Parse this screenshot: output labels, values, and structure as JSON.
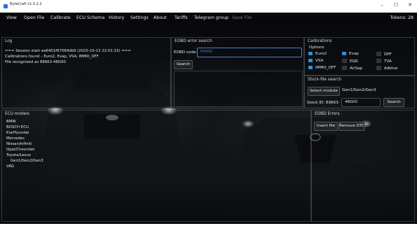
{
  "window": {
    "title": "ByteCraft v1.0.2.2"
  },
  "menu": {
    "items": [
      "View",
      "Open File",
      "Calibrate",
      "ECU Schema",
      "History",
      "Settings",
      "About",
      "Tariffs",
      "Telegram group"
    ],
    "save_file": "Save File",
    "tokens": "Tokens: 28"
  },
  "log": {
    "title": "Log",
    "lines": [
      "=== Session start ea6401f87064db9 (2025-10-13 22:01:15) ===",
      "Calibrations found – Euro2, Evap, VSA, IMMO_OFF",
      "File recognised as 89663-48G00"
    ]
  },
  "eobd_search": {
    "title": "EOBD error search",
    "code_label": "EOBD code:",
    "placeholder": "P0000",
    "search_button": "Search"
  },
  "calibrations": {
    "title": "Calibrations",
    "options_label": "Options",
    "items": [
      {
        "label": "Euro2",
        "checked": true
      },
      {
        "label": "Evap",
        "checked": true
      },
      {
        "label": "DPF",
        "checked": false
      },
      {
        "label": "VSA",
        "checked": true
      },
      {
        "label": "EGR",
        "checked": false
      },
      {
        "label": "TVA",
        "checked": false
      },
      {
        "label": "IMMO_OFF",
        "checked": true
      },
      {
        "label": "AirSap",
        "checked": false
      },
      {
        "label": "Adblue",
        "checked": false
      }
    ],
    "accent": "#2e8fdc"
  },
  "stock_search": {
    "title": "Stock-file search",
    "select_module": "Select module",
    "module_value": "Gen1/Gen2/Gen3",
    "stock_id_label": "Stock ID:",
    "stock_id_prefix": "89663-",
    "stock_id_value": "48G00",
    "search_button": "Search"
  },
  "ecu_models": {
    "title": "ECU models",
    "items": [
      "BMW",
      "BOSCH ECU",
      "Kia/Hyundai",
      "Mercedes",
      "Nissan/Infiniti",
      "Opel/Chevrolet",
      "Toyota/Lexus",
      "Gen1/Gen2/Gen3",
      "VAG"
    ]
  },
  "eobd_errors": {
    "title": "EOBD Errors",
    "insert_button": "Insert file",
    "remove_button": "Remove DTC"
  }
}
